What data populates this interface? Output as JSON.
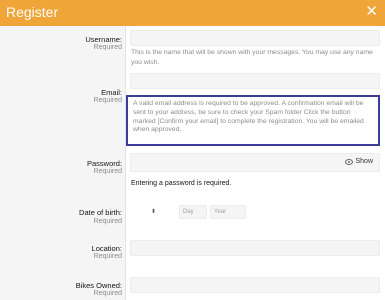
{
  "dialog": {
    "title": "Register",
    "close_glyph": "✕"
  },
  "fields": {
    "username": {
      "label": "Username:",
      "required": "Required",
      "hint": "This is the name that will be shown with your messages. You may use any name you wish."
    },
    "email": {
      "label": "Email:",
      "required": "Required",
      "hint": "A valid email address is required to be approved. A confirmation email will be sent to your address, be sure to check your Spam folder Click the button marked [Confirm your email] to complete the registration. You will be emailed when approved."
    },
    "password": {
      "label": "Password:",
      "required": "Required",
      "show_label": "Show",
      "error": "Entering a password is required."
    },
    "dob": {
      "label": "Date of birth:",
      "required": "Required",
      "month_glyph": "⬍",
      "day_placeholder": "Day",
      "year_placeholder": "Year"
    },
    "location": {
      "label": "Location:",
      "required": "Required"
    },
    "bikes": {
      "label": "Bikes Owned:",
      "required": "Required"
    }
  }
}
